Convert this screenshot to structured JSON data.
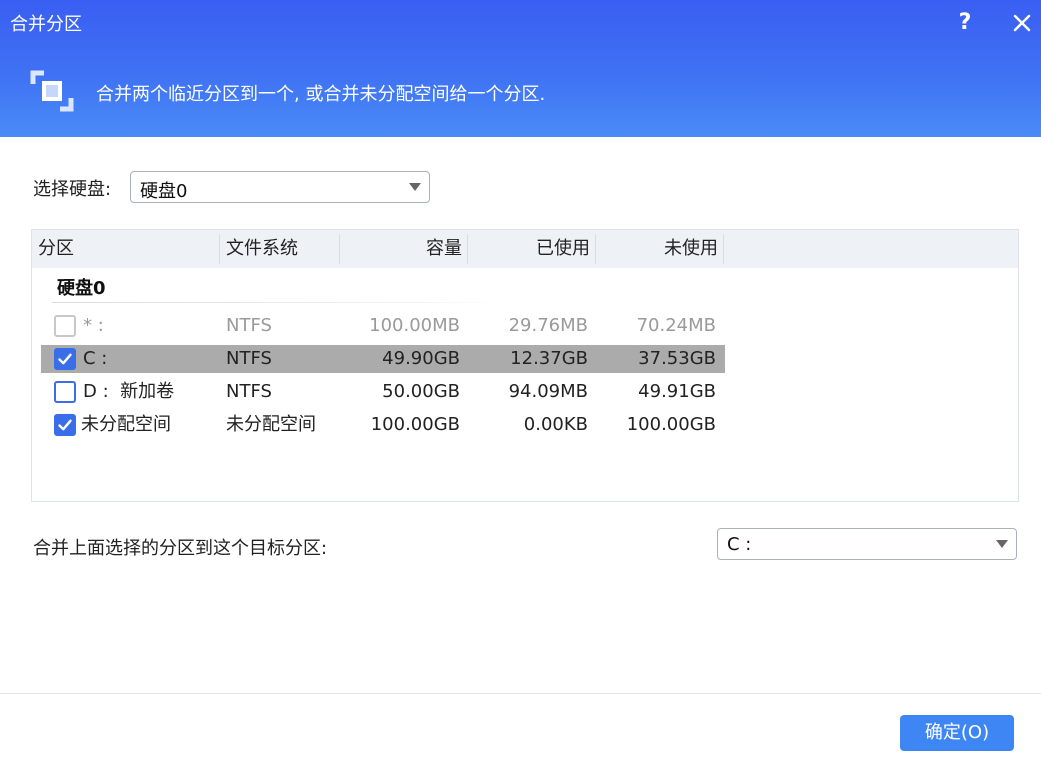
{
  "window": {
    "title": "合并分区",
    "help_label": "?",
    "description": "合并两个临近分区到一个, 或合并未分配空间给一个分区."
  },
  "disk_select": {
    "label": "选择硬盘:",
    "value": "硬盘0"
  },
  "table": {
    "columns": [
      "分区",
      "文件系统",
      "容量",
      "已使用",
      "未使用"
    ],
    "group_title": "硬盘0",
    "rows": [
      {
        "name": "* :",
        "fs": "NTFS",
        "capacity": "100.00MB",
        "used": "29.76MB",
        "unused": "70.24MB",
        "checked": false,
        "disabled": true,
        "selected": false
      },
      {
        "name": "C :",
        "fs": "NTFS",
        "capacity": "49.90GB",
        "used": "12.37GB",
        "unused": "37.53GB",
        "checked": true,
        "disabled": false,
        "selected": true
      },
      {
        "name": "D :  新加卷",
        "fs": "NTFS",
        "capacity": "50.00GB",
        "used": "94.09MB",
        "unused": "49.91GB",
        "checked": false,
        "disabled": false,
        "selected": false
      },
      {
        "name": "未分配空间",
        "fs": "未分配空间",
        "capacity": "100.00GB",
        "used": "0.00KB",
        "unused": "100.00GB",
        "checked": true,
        "disabled": false,
        "selected": false
      }
    ]
  },
  "target": {
    "label": "合并上面选择的分区到这个目标分区:",
    "value": "C :"
  },
  "footer": {
    "ok_label": "确定(O)"
  },
  "colors": {
    "header_gradient_top": "#3a5ef2",
    "header_gradient_bottom": "#4a8bf6",
    "checkbox_accent": "#3a6ee8",
    "selected_row": "#ababab",
    "ok_button": "#3f86f5"
  }
}
